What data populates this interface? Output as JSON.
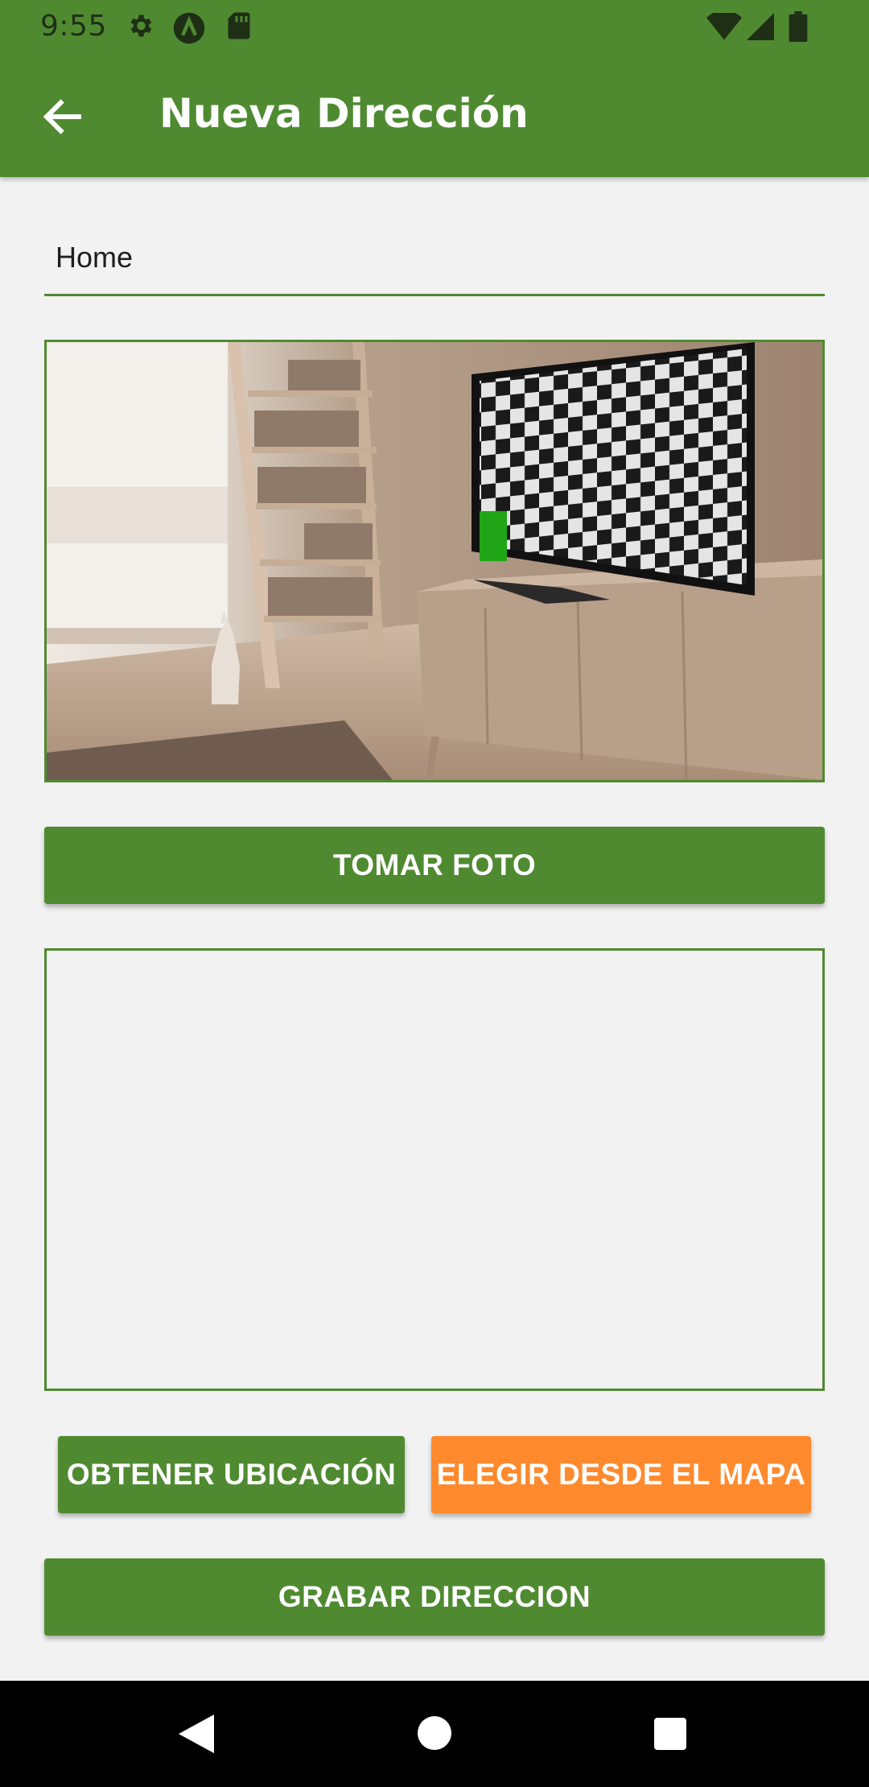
{
  "status_bar": {
    "time": "9:55",
    "icons": [
      "settings-icon",
      "a-circle-icon",
      "sd-card-icon",
      "wifi-icon",
      "cell-signal-icon",
      "battery-icon"
    ]
  },
  "app_bar": {
    "back_icon": "arrow-left-icon",
    "title": "Nueva Dirección"
  },
  "form": {
    "name_value": "Home",
    "take_photo_label": "TOMAR FOTO",
    "get_location_label": "OBTENER UBICACIÓN",
    "choose_map_label": "ELEGIR DESDE EL MAPA",
    "save_label": "GRABAR DIRECCION"
  },
  "nav_bar": {
    "icons": [
      "back-triangle-icon",
      "home-circle-icon",
      "recents-square-icon"
    ]
  },
  "colors": {
    "primary": "#4f8a30",
    "accent": "#ff8a2e",
    "background": "#f2f2f2"
  }
}
